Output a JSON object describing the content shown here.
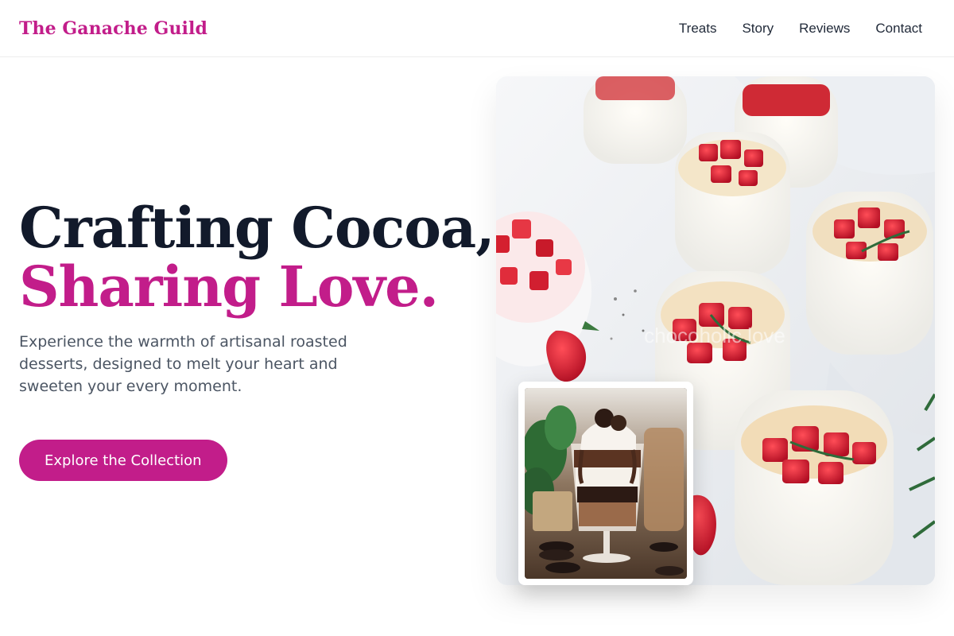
{
  "brand": {
    "name": "The Ganache Guild"
  },
  "nav": {
    "items": [
      {
        "label": "Treats"
      },
      {
        "label": "Story"
      },
      {
        "label": "Reviews"
      },
      {
        "label": "Contact"
      }
    ]
  },
  "hero": {
    "title_line1": "Crafting Cocoa,",
    "title_line2": "Sharing Love.",
    "subtitle": "Experience the warmth of artisanal roasted desserts, designed to melt your heart and sweeten your every moment.",
    "cta_label": "Explore the Collection"
  },
  "images": {
    "main": {
      "description": "glass jars of panna cotta topped with chopped strawberries and rosemary on a white cloth",
      "watermark": "chocoholic love"
    },
    "inset": {
      "description": "chocolate parfait in a stemmed glass with cookies and chocolate drizzle"
    }
  },
  "colors": {
    "accent": "#c21d8a",
    "heading_dark": "#121a2b",
    "body_text": "#4b5563",
    "nav_text": "#222b3a",
    "background": "#ffffff"
  }
}
